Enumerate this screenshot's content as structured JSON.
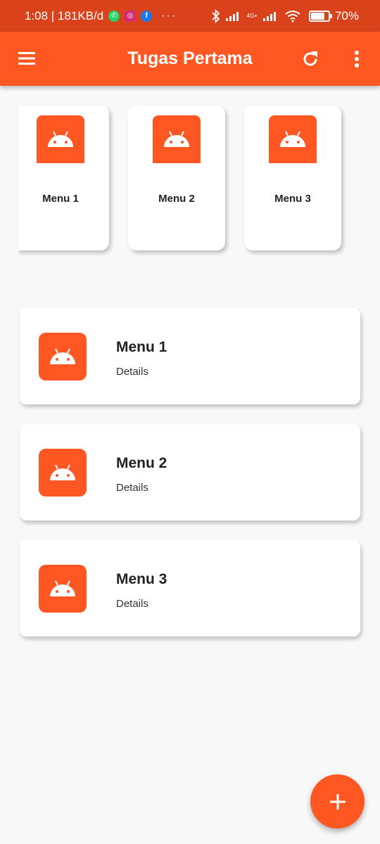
{
  "status_bar": {
    "time_speed": "1:08 | 181KB/d",
    "network_label": "4G+",
    "battery_percent": "70%",
    "more_dots": "···"
  },
  "app_bar": {
    "title": "Tugas Pertama",
    "icons": [
      "menu-icon",
      "refresh-icon",
      "more-vert-icon"
    ]
  },
  "horizontal_menu": [
    {
      "label": "Menu 1",
      "icon": "android-icon"
    },
    {
      "label": "Menu 2",
      "icon": "android-icon"
    },
    {
      "label": "Menu 3",
      "icon": "android-icon"
    }
  ],
  "vertical_menu": [
    {
      "title": "Menu 1",
      "subtitle": "Details",
      "icon": "android-icon"
    },
    {
      "title": "Menu 2",
      "subtitle": "Details",
      "icon": "android-icon"
    },
    {
      "title": "Menu 3",
      "subtitle": "Details",
      "icon": "android-icon"
    }
  ],
  "fab": {
    "icon": "add-icon"
  },
  "colors": {
    "primary": "#ff5722",
    "status_bar": "#d9421b",
    "background": "#f8f8f8",
    "card": "#ffffff"
  }
}
